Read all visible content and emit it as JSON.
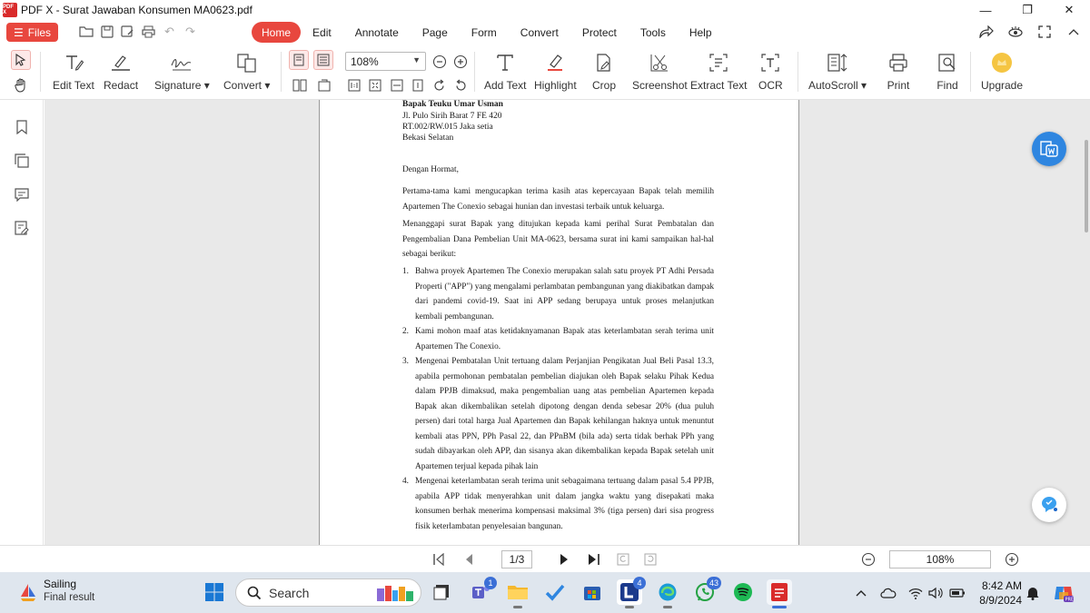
{
  "window": {
    "title": "PDF X - Surat Jawaban Konsumen MA0623.pdf",
    "logo_text": "PDF X",
    "minimize": "—",
    "maximize": "❐",
    "close": "✕"
  },
  "menubar": {
    "files_label": "Files",
    "tabs": [
      {
        "label": "Home",
        "active": true
      },
      {
        "label": "Edit"
      },
      {
        "label": "Annotate"
      },
      {
        "label": "Page"
      },
      {
        "label": "Form"
      },
      {
        "label": "Convert"
      },
      {
        "label": "Protect"
      },
      {
        "label": "Tools"
      },
      {
        "label": "Help"
      }
    ]
  },
  "toolbar": {
    "edit_text": "Edit Text",
    "redact": "Redact",
    "signature": "Signature ▾",
    "convert": "Convert ▾",
    "zoom_value": "108%",
    "add_text": "Add Text",
    "highlight": "Highlight",
    "crop": "Crop",
    "screenshot": "Screenshot",
    "extract_text": "Extract Text",
    "ocr": "OCR",
    "autoscroll": "AutoScroll ▾",
    "print": "Print",
    "find": "Find",
    "upgrade": "Upgrade"
  },
  "document": {
    "address": [
      "Bapak Teuku Umar Usman",
      "Jl. Pulo Sirih Barat 7 FE 420",
      " RT.002/RW.015 Jaka setia",
      "Bekasi Selatan"
    ],
    "greeting": "Dengan Hormat,",
    "para1": "Pertama-tama kami mengucapkan terima kasih atas kepercayaan Bapak telah memilih Apartemen The Conexio sebagai hunian dan investasi terbaik untuk keluarga.",
    "para2": "Menanggapi surat Bapak yang ditujukan kepada kami perihal Surat Pembatalan dan Pengembalian Dana Pembelian Unit MA-0623, bersama surat ini kami sampaikan hal-hal sebagai berikut:",
    "items": [
      {
        "num": "1.",
        "text": "Bahwa proyek Apartemen The Conexio merupakan salah satu proyek PT Adhi Persada Properti (\"APP\") yang mengalami perlambatan pembangunan yang diakibatkan dampak dari pandemi covid-19.  Saat ini APP sedang berupaya untuk proses melanjutkan kembali pembangunan."
      },
      {
        "num": "2.",
        "text": "Kami mohon maaf atas ketidaknyamanan Bapak atas keterlambatan serah terima unit Apartemen The Conexio."
      },
      {
        "num": "3.",
        "text": "Mengenai Pembatalan Unit tertuang dalam Perjanjian Pengikatan Jual Beli Pasal 13.3, apabila permohonan pembatalan pembelian diajukan oleh Bapak selaku Pihak Kedua dalam PPJB dimaksud, maka pengembalian uang atas pembelian Apartemen kepada Bapak akan dikembalikan setelah dipotong dengan denda sebesar 20% (dua puluh persen)  dari total harga Jual Apartemen dan Bapak  kehilangan haknya untuk menuntut kembali atas PPN, PPh Pasal 22, dan PPnBM (bila ada) serta tidak berhak PPh yang sudah dibayarkan oleh APP, dan sisanya akan dikembalikan kepada Bapak setelah unit Apartemen terjual kepada pihak lain"
      },
      {
        "num": "4.",
        "text": "Mengenai keterlambatan serah terima unit sebagaimana tertuang dalam pasal 5.4 PPJB, apabila APP tidak menyerahkan unit dalam jangka waktu yang disepakati maka konsumen berhak menerima kompensasi maksimal 3% (tiga persen) dari sisa progress fisik keterlambatan penyelesaian bangunan."
      }
    ]
  },
  "bottom": {
    "page_indicator": "1/3",
    "zoom_value": "108%"
  },
  "taskbar": {
    "weather_title": "Sailing",
    "weather_sub": "Final result",
    "search_placeholder": "Search",
    "teams_badge": "1",
    "l_badge": "4",
    "whatsapp_badge": "43",
    "time": "8:42 AM",
    "date": "8/9/2024"
  },
  "colors": {
    "accent": "#e8473e",
    "word_blue": "#2f86e0",
    "taskbar": "#dfe6ee"
  }
}
